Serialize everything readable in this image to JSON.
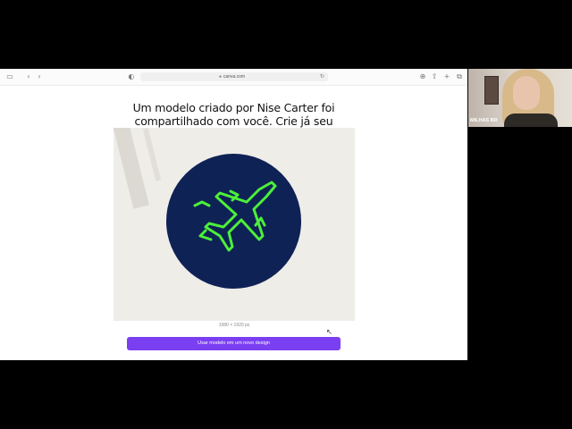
{
  "browser": {
    "url": "canva.com",
    "icons": {
      "sidebar": "sidebar-icon",
      "back": "chevron-left-icon",
      "forward": "chevron-right-icon",
      "shield": "shield-icon",
      "download": "download-icon",
      "share": "share-icon",
      "new_tab": "plus-icon",
      "tabs": "tabs-icon",
      "reload": "reload-icon",
      "lock": "lock-icon"
    }
  },
  "page": {
    "headline": "Um modelo criado por Nise Carter foi compartilhado com você. Crie já seu design.",
    "size_label": "1080 × 1920 px",
    "cta_label": "Usar modelo em um novo design",
    "logo_icon": "airplane-icon",
    "colors": {
      "logo_bg": "#0f2255",
      "logo_fg": "#4cf03a",
      "cta": "#7b3ff2"
    }
  },
  "webcam": {
    "name": "MILHAS BR"
  }
}
